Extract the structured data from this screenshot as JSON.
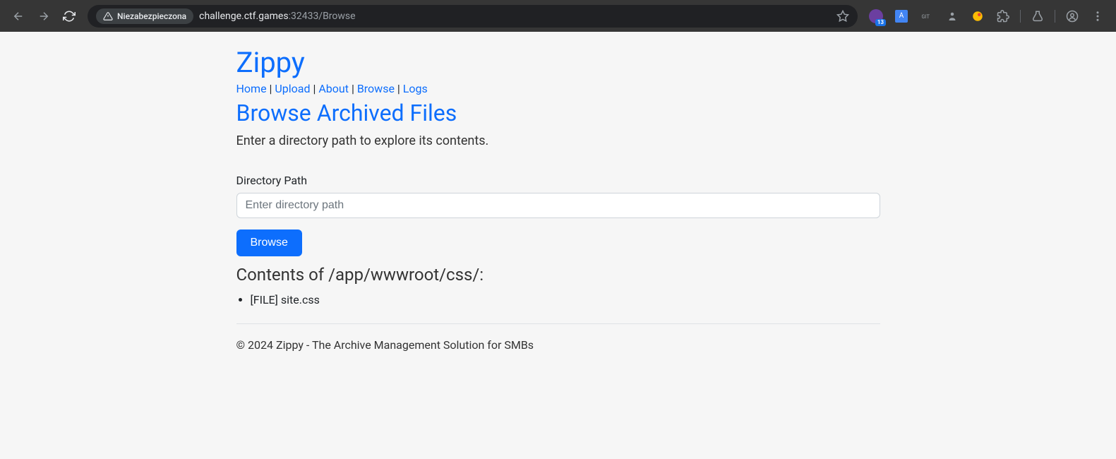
{
  "browser": {
    "security_label": "Niezabezpieczona",
    "url_host": "challenge.ctf.games",
    "url_path": ":32433/Browse",
    "ext_badge": "13"
  },
  "site": {
    "title": "Zippy",
    "nav": {
      "home": "Home",
      "upload": "Upload",
      "about": "About",
      "browse": "Browse",
      "logs": "Logs"
    }
  },
  "page": {
    "heading": "Browse Archived Files",
    "description": "Enter a directory path to explore its contents.",
    "field_label": "Directory Path",
    "placeholder": "Enter directory path",
    "button": "Browse",
    "contents_label": "Contents of /app/wwwroot/css/:",
    "files": [
      "[FILE] site.css"
    ]
  },
  "footer": {
    "text": "© 2024 Zippy - The Archive Management Solution for SMBs"
  }
}
